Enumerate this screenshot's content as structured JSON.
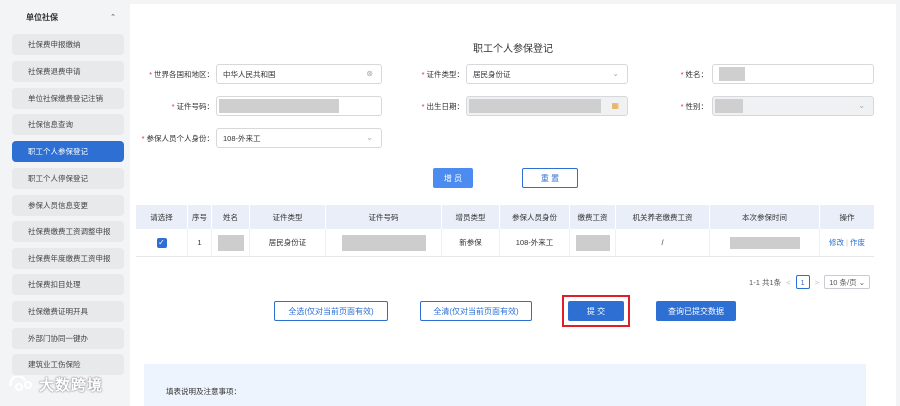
{
  "sidebar": {
    "header": "单位社保",
    "items": [
      {
        "label": "社保费申报缴纳"
      },
      {
        "label": "社保费退费申请"
      },
      {
        "label": "单位社保缴费登记注销"
      },
      {
        "label": "社保信息查询"
      },
      {
        "label": "职工个人参保登记",
        "active": true
      },
      {
        "label": "职工个人停保登记"
      },
      {
        "label": "参保人员信息变更"
      },
      {
        "label": "社保费缴费工资调整申报"
      },
      {
        "label": "社保费年度缴费工资申报"
      },
      {
        "label": "社保费扣目处理"
      },
      {
        "label": "社保缴费证明开具"
      },
      {
        "label": "外部门协同一键办"
      },
      {
        "label": "建筑业工伤保险"
      }
    ]
  },
  "form": {
    "title": "职工个人参保登记",
    "country_label": "世界各国和地区：",
    "country_value": "中华人民共和国",
    "id_type_label": "证件类型：",
    "id_type_value": "居民身份证",
    "name_label": "姓名：",
    "id_number_label": "证件号码：",
    "birth_label": "出生日期：",
    "gender_label": "性别：",
    "identity_label": "参保人员个人身份：",
    "identity_value": "108-外来工",
    "add_button": "增 员",
    "reset_button": "重 置"
  },
  "table": {
    "headers": [
      "请选择",
      "序号",
      "姓名",
      "证件类型",
      "证件号码",
      "增员类型",
      "参保人员身份",
      "缴费工资",
      "机关养老缴费工资",
      "本次参保时间",
      "操作"
    ],
    "rows": [
      {
        "index": "1",
        "id_type": "居民身份证",
        "add_type": "新参保",
        "identity": "108-外来工",
        "gov_pension_wage": "/",
        "edit": "修改",
        "delete": "作废"
      }
    ]
  },
  "pager": {
    "summary": "1-1 共1条",
    "prev": "<",
    "current": "1",
    "next": ">",
    "page_size": "10 条/页"
  },
  "actions": {
    "select_all": "全选(仅对当前页面有效)",
    "clear_all": "全清(仅对当前页面有效)",
    "submit": "提 交",
    "query_submitted": "查询已提交数据"
  },
  "notes": {
    "title": "填表说明及注意事项："
  },
  "watermark": {
    "text": "大数跨境"
  },
  "colors": {
    "primary": "#2d6fd3",
    "highlight": "#e11d2a",
    "table_header": "#e9eef8"
  }
}
